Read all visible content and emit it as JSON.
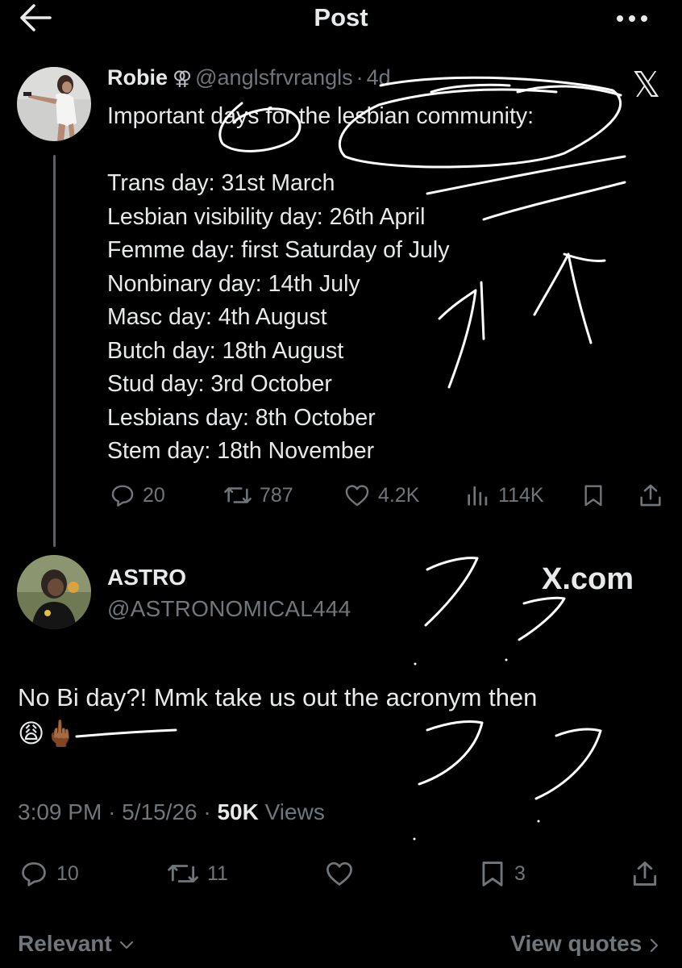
{
  "header": {
    "title": "Post",
    "back_icon": "arrow-left-icon",
    "more_icon": "more-horizontal-icon"
  },
  "quoted_post": {
    "author_name": "Robie",
    "gender_symbol": "⚢",
    "handle": "@anglsfrvrangls",
    "separator": "·",
    "age": "4d",
    "brand_icon": "𝕏",
    "lines": [
      "Important days for the lesbian community:",
      "",
      "Trans day: 31st March",
      "Lesbian visibility day: 26th April",
      "Femme day: first Saturday of July",
      "Nonbinary day: 14th July",
      "Masc day: 4th August",
      "Butch day: 18th August",
      "Stud day: 3rd October",
      "Lesbians day: 8th October",
      "Stem day: 18th November"
    ],
    "replies": "20",
    "reposts": "787",
    "likes": "4.2K",
    "views": "114K"
  },
  "reply_post": {
    "author_name": "ASTRO",
    "handle": "@ASTRONOMICAL444",
    "watermark": "X.com",
    "text": "No Bi day?! Mmk take us out the acronym then",
    "emojis": "😩🖕🏾",
    "time": "3:09 PM",
    "date": "5/15/26",
    "separator": "·",
    "views_count": "50K",
    "views_label": "Views",
    "replies": "10",
    "reposts": "11",
    "bookmarks": "3"
  },
  "footer": {
    "sort_label": "Relevant",
    "quotes_label": "View quotes"
  },
  "colors": {
    "background": "#000000",
    "text": "#e7e9ea",
    "secondary": "#71767b",
    "thread_line": "#5b6066",
    "scribble": "#ffffff"
  }
}
